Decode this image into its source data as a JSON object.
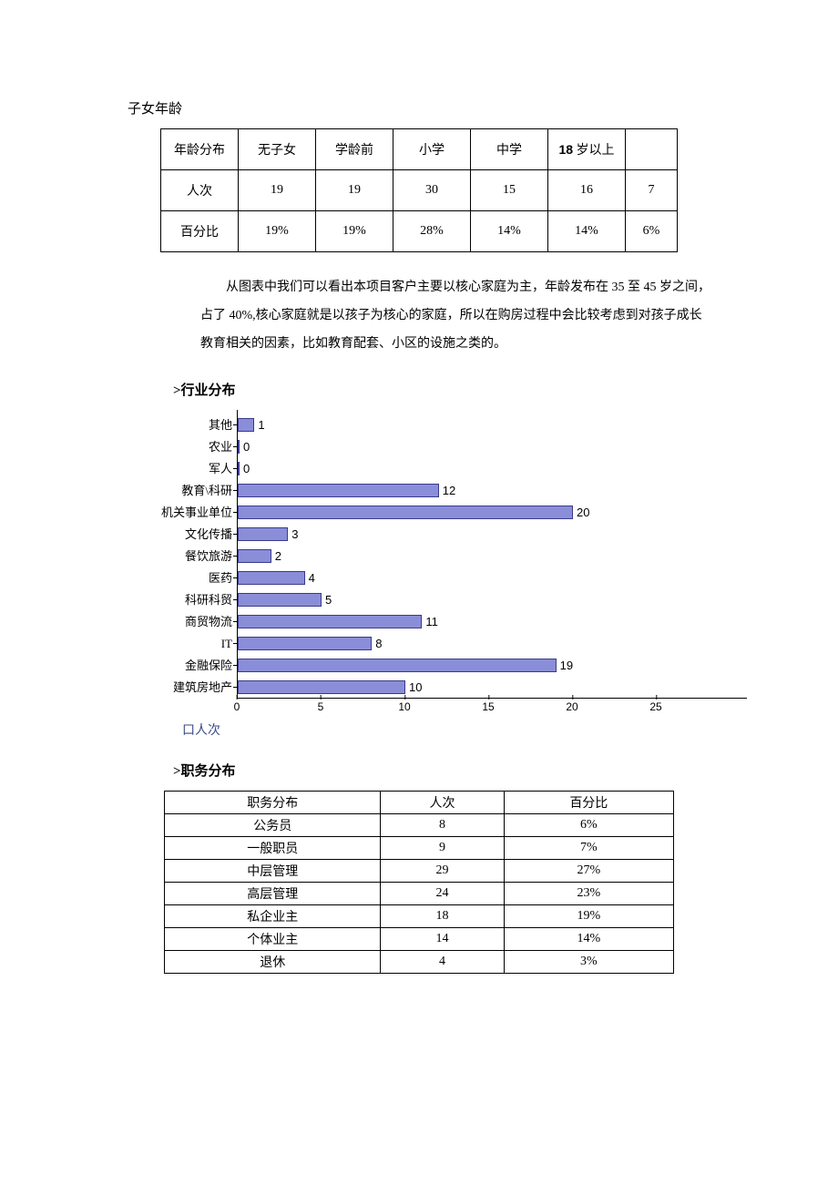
{
  "headings": {
    "children_age": "子女年龄",
    "industry": ">行业分布",
    "position": ">职务分布"
  },
  "table1": {
    "header": [
      "年龄分布",
      "无子女",
      "学龄前",
      "小学",
      "中学",
      "18 岁以上",
      ""
    ],
    "counts_label": "人次",
    "counts": [
      "19",
      "19",
      "30",
      "15",
      "16",
      "7"
    ],
    "pct_label": "百分比",
    "pct": [
      "19%",
      "19%",
      "28%",
      "14%",
      "14%",
      "6%"
    ]
  },
  "paragraph": "从图表中我们可以看出本项目客户主要以核心家庭为主，年龄发布在 35 至 45 岁之间，占了 40%,核心家庭就是以孩子为核心的家庭，所以在购房过程中会比较考虑到对孩子成长教育相关的因素，比如教育配套、小区的设施之类的。",
  "chart_data": {
    "type": "bar",
    "orientation": "horizontal",
    "categories": [
      "其他",
      "农业",
      "军人",
      "教育\\科研",
      "机关事业单位",
      "文化传播",
      "餐饮旅游",
      "医药",
      "科研科贸",
      "商贸物流",
      "IT",
      "金融保险",
      "建筑房地产"
    ],
    "values": [
      1,
      0,
      0,
      12,
      20,
      3,
      2,
      4,
      5,
      11,
      8,
      19,
      10
    ],
    "xlabel": "",
    "ylabel": "",
    "xlim": [
      0,
      25
    ],
    "xticks": [
      0,
      5,
      10,
      15,
      20,
      25
    ],
    "series_name": "人次",
    "bar_color": "#8a8ed8"
  },
  "legend_note": "口人次",
  "table2": {
    "header": [
      "职务分布",
      "人次",
      "百分比"
    ],
    "rows": [
      [
        "公务员",
        "8",
        "6%"
      ],
      [
        "一般职员",
        "9",
        "7%"
      ],
      [
        "中层管理",
        "29",
        "27%"
      ],
      [
        "高层管理",
        "24",
        "23%"
      ],
      [
        "私企业主",
        "18",
        "19%"
      ],
      [
        "个体业主",
        "14",
        "14%"
      ],
      [
        "退休",
        "4",
        "3%"
      ]
    ]
  }
}
